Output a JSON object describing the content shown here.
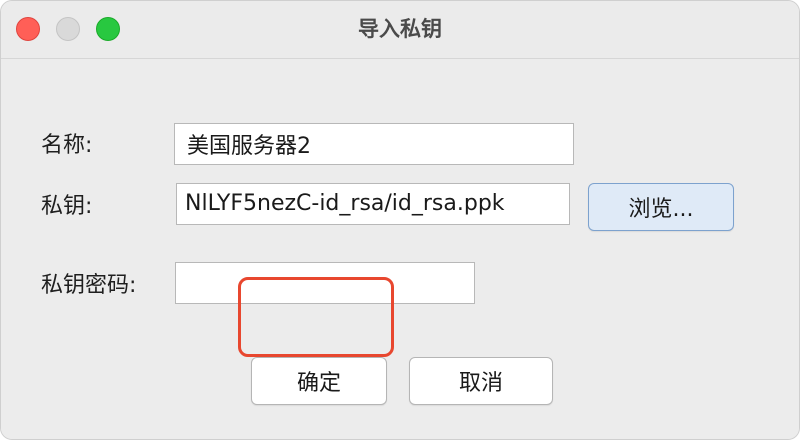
{
  "window": {
    "title": "导入私钥",
    "controls": {
      "close": "close",
      "minimize": "minimize",
      "zoom": "zoom"
    }
  },
  "form": {
    "name_label": "名称:",
    "name_value": "美国服务器2",
    "key_label": "私钥:",
    "key_value": "NlLYF5nezC-id_rsa/id_rsa.ppk",
    "browse_label": "浏览...",
    "password_label": "私钥密码:",
    "password_value": ""
  },
  "actions": {
    "ok_label": "确定",
    "cancel_label": "取消"
  },
  "colors": {
    "highlight": "#e8472f",
    "browse_bg": "#dfeaf7",
    "close": "#ff5f57",
    "zoom": "#28c840"
  }
}
